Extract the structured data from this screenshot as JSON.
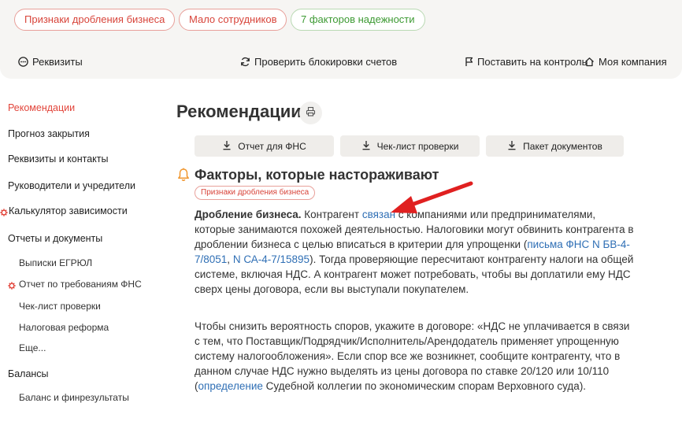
{
  "top_tags": [
    {
      "label": "Признаки дробления бизнеса",
      "tone": "red"
    },
    {
      "label": "Мало сотрудников",
      "tone": "red"
    },
    {
      "label": "7 факторов надежности",
      "tone": "green"
    }
  ],
  "toolbar": {
    "requisites": "Реквизиты",
    "check_blocks": "Проверить блокировки счетов",
    "monitor": "Поставить на контроль",
    "my_company": "Моя компания"
  },
  "sidebar": {
    "items": [
      {
        "label": "Рекомендации",
        "active": true
      },
      {
        "label": "Прогноз закрытия"
      },
      {
        "label": "Реквизиты и контакты"
      },
      {
        "label": "Руководители и учредители"
      },
      {
        "label": "Калькулятор зависимости",
        "icon": "gear-icon"
      },
      {
        "label": "Отчеты и документы"
      },
      {
        "label": "Выписки ЕГРЮЛ"
      },
      {
        "label": "Отчет по требованиям ФНС",
        "icon": "gear-icon"
      },
      {
        "label": "Чек-лист проверки"
      },
      {
        "label": "Налоговая реформа"
      },
      {
        "label": "Еще..."
      },
      {
        "label": "Балансы"
      },
      {
        "label": "Баланс и финрезультаты"
      }
    ]
  },
  "main": {
    "title": "Рекомендации",
    "buttons": {
      "fns_report": "Отчет для ФНС",
      "checklist": "Чек-лист проверки",
      "docs_pack": "Пакет документов"
    },
    "section": {
      "title": "Факторы, которые настораживают",
      "tag": "Признаки дробления бизнеса"
    },
    "para1": {
      "bold": "Дробление бизнеса.",
      "t1": " Контрагент ",
      "link1": "связан",
      "t2": " с компаниями или предпринимателями, которые занимаются похожей деятельностью. Налоговики могут обвинить контрагента в дроблении бизнеса с целью вписаться в критерии для упрощенки (",
      "link2": "письма ФНС N БВ-4-7/8051",
      "t3": ", ",
      "link3": "N СА-4-7/15895",
      "t4": "). Тогда проверяющие пересчитают контрагенту налоги на общей системе, включая НДС. А контрагент может потребовать, чтобы вы доплатили ему НДС сверх цены договора, если вы выступали покупателем."
    },
    "para2": {
      "t1": "Чтобы снизить вероятность споров, укажите в договоре: «НДС не уплачивается в связи с тем, что Поставщик/Подрядчик/Исполнитель/Арендодатель применяет упрощенную систему налогообложения». Если спор все же возникнет, сообщите контрагенту, что в данном случае НДС нужно выделять из цены договора по ставке 20/120 или 10/110 (",
      "link": "определение",
      "t2": " Судебной коллегии по экономическим спорам Верховного суда)."
    }
  },
  "colors": {
    "accent_red": "#e2453b",
    "link_blue": "#2f6fb5",
    "tag_green": "#3d9a33",
    "topbar_bg": "#f6f5f3"
  }
}
